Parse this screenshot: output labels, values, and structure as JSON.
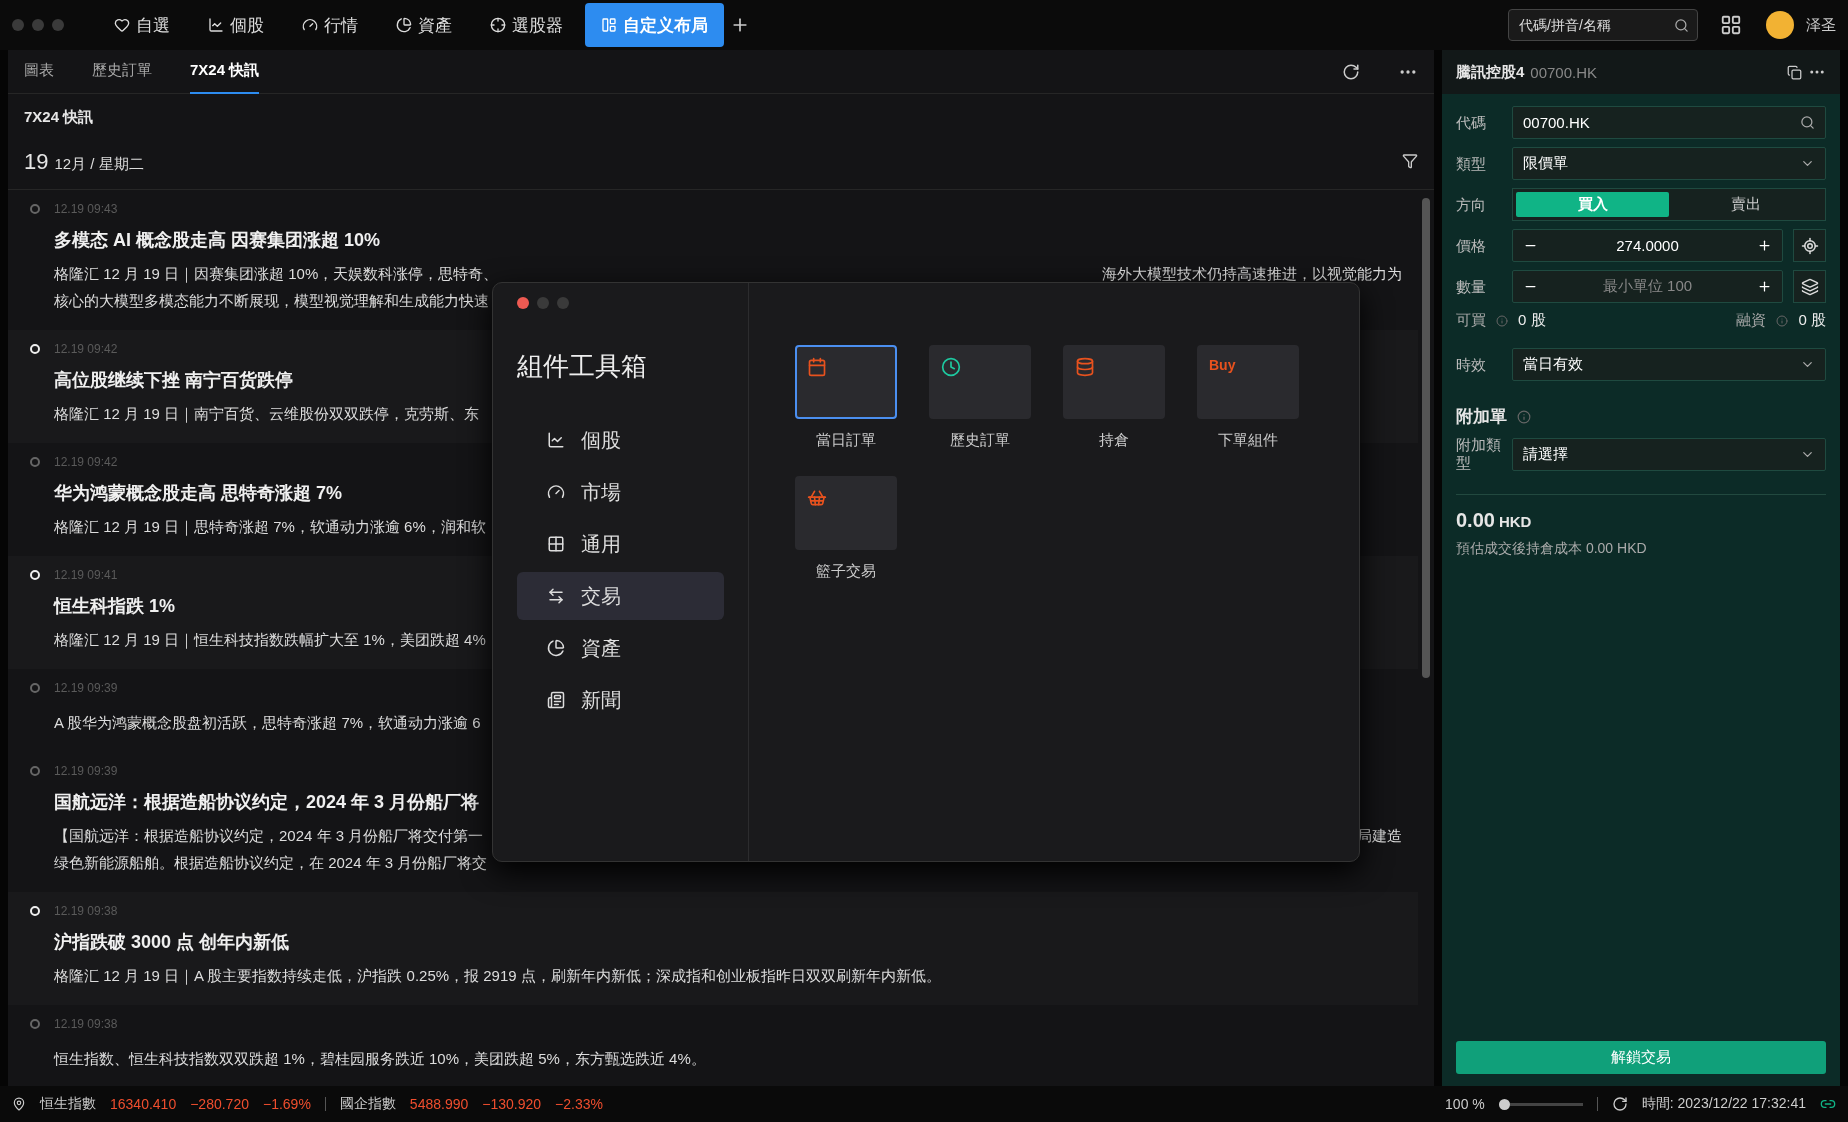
{
  "top_nav": {
    "tabs": [
      {
        "label": "自選",
        "selected": false
      },
      {
        "label": "個股",
        "selected": false
      },
      {
        "label": "行情",
        "selected": false
      },
      {
        "label": "資產",
        "selected": false
      },
      {
        "label": "選股器",
        "selected": false
      },
      {
        "label": "自定义布局",
        "selected": true
      }
    ],
    "search": {
      "placeholder": "代碼/拼音/名稱"
    },
    "user": "泽圣"
  },
  "main": {
    "tabs": [
      {
        "label": "圖表",
        "selected": false
      },
      {
        "label": "歷史訂單",
        "selected": false
      },
      {
        "label": "7X24 快訊",
        "selected": true
      }
    ],
    "heading": "7X24 快訊",
    "day": "19",
    "date": "12月 / 星期二",
    "news": [
      {
        "time": "12.19 09:43",
        "marked": false,
        "title": "多模态 AI 概念股走高 因赛集团涨超 10%",
        "lines": [
          {
            "text": "格隆汇 12 月 19 日｜因赛集团涨超 10%，天娱数科涨停，思特奇、",
            "tail": "海外大模型技术仍持高速推进，以视觉能力为"
          },
          {
            "text": "核心的大模型多模态能力不断展现，模型视觉理解和生成能力快速"
          }
        ]
      },
      {
        "time": "12.19 09:42",
        "marked": true,
        "title": "高位股继续下挫 南宁百货跌停",
        "lines": [
          {
            "text": "格隆汇 12 月 19 日｜南宁百货、云维股份双双跌停，克劳斯、东"
          }
        ]
      },
      {
        "time": "12.19 09:42",
        "marked": false,
        "title": "华为鸿蒙概念股走高 思特奇涨超 7%",
        "lines": [
          {
            "text": "格隆汇 12 月 19 日｜思特奇涨超 7%，软通动力涨逾 6%，润和软"
          }
        ]
      },
      {
        "time": "12.19 09:41",
        "marked": true,
        "title": "恒生科指跌 1%",
        "lines": [
          {
            "text": "格隆汇 12 月 19 日｜恒生科技指数跌幅扩大至 1%，美团跌超 4%"
          }
        ]
      },
      {
        "time": "12.19 09:39",
        "marked": false,
        "lines": [
          {
            "text": "A 股华为鸿蒙概念股盘初活跃，思特奇涨超 7%，软通动力涨逾 6"
          }
        ]
      },
      {
        "time": "12.19 09:39",
        "marked": false,
        "title": "国航远洋：根据造船协议约定，2024 年 3 月份船厂将",
        "lines": [
          {
            "text": "【国航远洋：根据造船协议约定，2024 年 3 月份船厂将交付第一",
            "tail": "局建造"
          },
          {
            "text": "绿色新能源船舶。根据造船协议约定，在 2024 年 3 月份船厂将交"
          }
        ]
      },
      {
        "time": "12.19 09:38",
        "marked": true,
        "title": "沪指跌破 3000 点 创年内新低",
        "lines": [
          {
            "text": "格隆汇 12 月 19 日｜A 股主要指数持续走低，沪指跌 0.25%，报 2919 点，刷新年内新低；深成指和创业板指昨日双双刷新年内新低。"
          }
        ]
      },
      {
        "time": "12.19 09:38",
        "marked": false,
        "lines": [
          {
            "text": "恒生指数、恒生科技指数双双跌超 1%，碧桂园服务跌近 10%，美团跌超 5%，东方甄选跌近 4%。"
          }
        ]
      }
    ]
  },
  "toolbox": {
    "title": "組件工具箱",
    "categories": [
      {
        "label": "個股",
        "selected": false
      },
      {
        "label": "市場",
        "selected": false
      },
      {
        "label": "通用",
        "selected": false
      },
      {
        "label": "交易",
        "selected": true
      },
      {
        "label": "資產",
        "selected": false
      },
      {
        "label": "新聞",
        "selected": false
      }
    ],
    "widgets": [
      {
        "label": "當日訂單",
        "kind": "calendar",
        "color": "#e8521e",
        "selected": true
      },
      {
        "label": "歷史訂單",
        "kind": "clock",
        "color": "#1ec9a0",
        "selected": false
      },
      {
        "label": "持倉",
        "kind": "coins",
        "color": "#e8521e",
        "selected": false
      },
      {
        "label": "下單組件",
        "kind": "text",
        "badge": "Buy",
        "color": "#e8521e",
        "selected": false
      },
      {
        "label": "籃子交易",
        "kind": "basket",
        "color": "#e8521e",
        "selected": false
      }
    ]
  },
  "order_panel": {
    "title": "騰訊控股4",
    "code": "00700.HK",
    "fields": [
      {
        "label": "代碼",
        "value": "00700.HK",
        "kind": "search"
      },
      {
        "label": "類型",
        "value": "限價單",
        "kind": "select"
      }
    ],
    "direction": {
      "label": "方向",
      "options": [
        {
          "label": "買入",
          "selected": true
        },
        {
          "label": "賣出",
          "selected": false
        }
      ]
    },
    "steppers": [
      {
        "label": "價格",
        "value": "274.0000"
      },
      {
        "label": "數量",
        "placeholder": "最小單位 100"
      }
    ],
    "buyable": {
      "label": "可買",
      "value": "0 股"
    },
    "margin": {
      "label": "融資",
      "value": "0 股"
    },
    "validity": {
      "label": "時效",
      "value": "當日有效"
    },
    "attach": {
      "heading": "附加單",
      "label": "附加類型",
      "value": "請選擇"
    },
    "total": "0.00",
    "currency": "HKD",
    "estimate": "預估成交後持倉成本 0.00 HKD",
    "submit": "解鎖交易"
  },
  "status_bar": {
    "indices": [
      {
        "name": "恒生指數",
        "price": "16340.410",
        "change": "−280.720",
        "pct": "−1.69%"
      },
      {
        "name": "國企指數",
        "price": "5488.990",
        "change": "−130.920",
        "pct": "−2.33%"
      }
    ],
    "zoom": {
      "reading": "100 %",
      "level": 0
    },
    "time": "時間: 2023/12/22 17:32:41"
  }
}
